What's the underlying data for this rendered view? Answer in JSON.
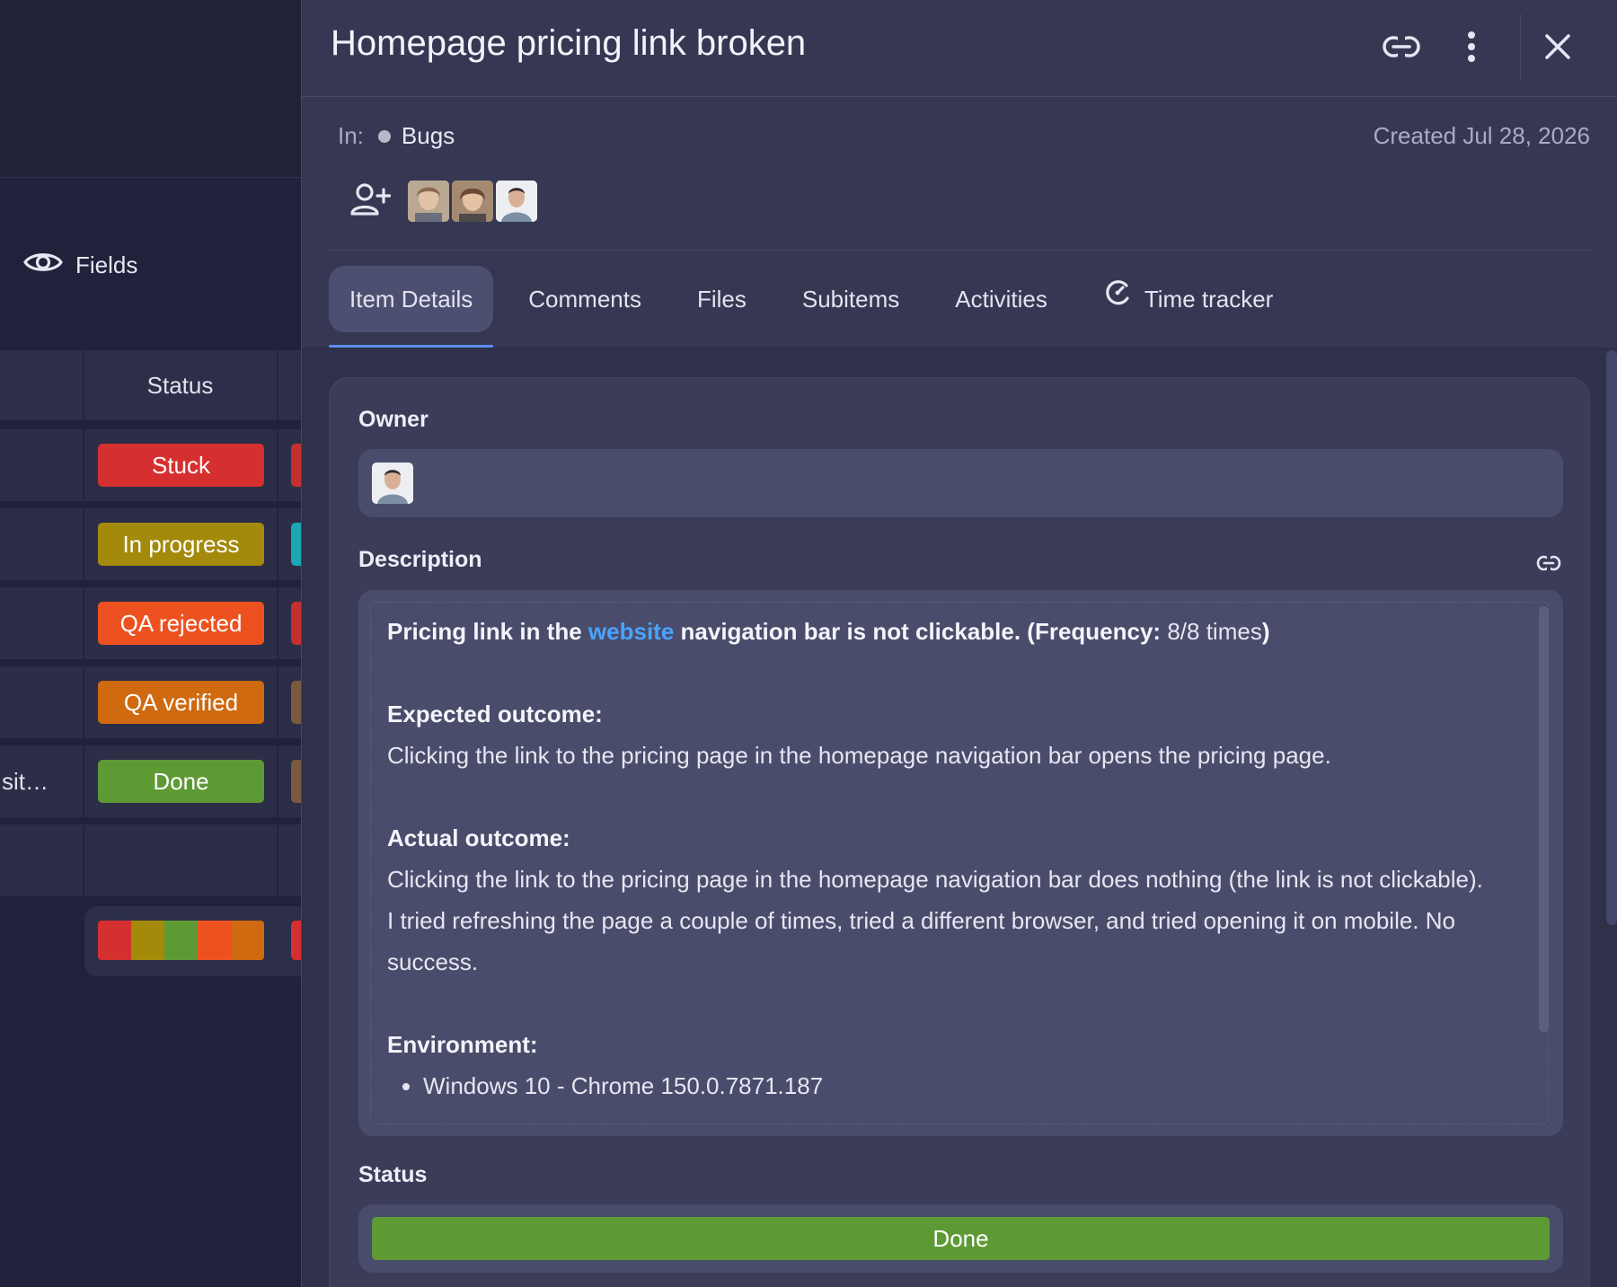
{
  "board": {
    "fields_label": "Fields",
    "status_header": "Status",
    "rows": [
      {
        "name": "",
        "status": "Stuck",
        "color": "#d5302f",
        "stub_color": "#c43030"
      },
      {
        "name": "",
        "status": "In progress",
        "color": "#a48a0b",
        "stub_color": "#1da6b3"
      },
      {
        "name": "",
        "status": "QA rejected",
        "color": "#ee5120",
        "stub_color": "#c43030"
      },
      {
        "name": "",
        "status": "QA verified",
        "color": "#cf6a10",
        "stub_color": "#7a5a3c"
      },
      {
        "name": "sit…",
        "status": "Done",
        "color": "#5e9a34",
        "stub_color": "#7a5a3c"
      },
      {
        "name": "",
        "status": "",
        "color": "",
        "stub_color": ""
      }
    ],
    "summary_colors": [
      "#d5302f",
      "#a48a0b",
      "#5e9a34",
      "#ee5120",
      "#cf6a10"
    ]
  },
  "item": {
    "title": "Homepage pricing link broken",
    "in_label": "In:",
    "group": "Bugs",
    "created": "Created Jul 28, 2026",
    "tabs": [
      {
        "label": "Item Details",
        "active": true
      },
      {
        "label": "Comments",
        "active": false
      },
      {
        "label": "Files",
        "active": false
      },
      {
        "label": "Subitems",
        "active": false
      },
      {
        "label": "Activities",
        "active": false
      },
      {
        "label": "Time tracker",
        "active": false,
        "icon": "time-tracker-icon"
      }
    ],
    "owner_label": "Owner",
    "description_label": "Description",
    "description": {
      "line1_a": "Pricing link in the ",
      "line1_link": "website",
      "line1_b": " navigation bar is not clickable. (Frequency:",
      "line1_c": " 8/8 times",
      "line1_d": ")",
      "expected_heading": "Expected outcome:",
      "expected_text": "Clicking the link to the pricing page in the homepage navigation bar opens the pricing page.",
      "actual_heading": "Actual outcome:",
      "actual_text_1": "Clicking the link to the pricing page in the homepage navigation bar does nothing (the link is not clickable).",
      "actual_text_2": "I tried refreshing the page a couple of times, tried a different browser, and tried opening it on mobile. No success.",
      "environment_heading": "Environment:",
      "environment_items": [
        "Windows 10 - Chrome 150.0.7871.187"
      ]
    },
    "status_label": "Status",
    "status_value": "Done",
    "status_color": "#5e9a34"
  }
}
